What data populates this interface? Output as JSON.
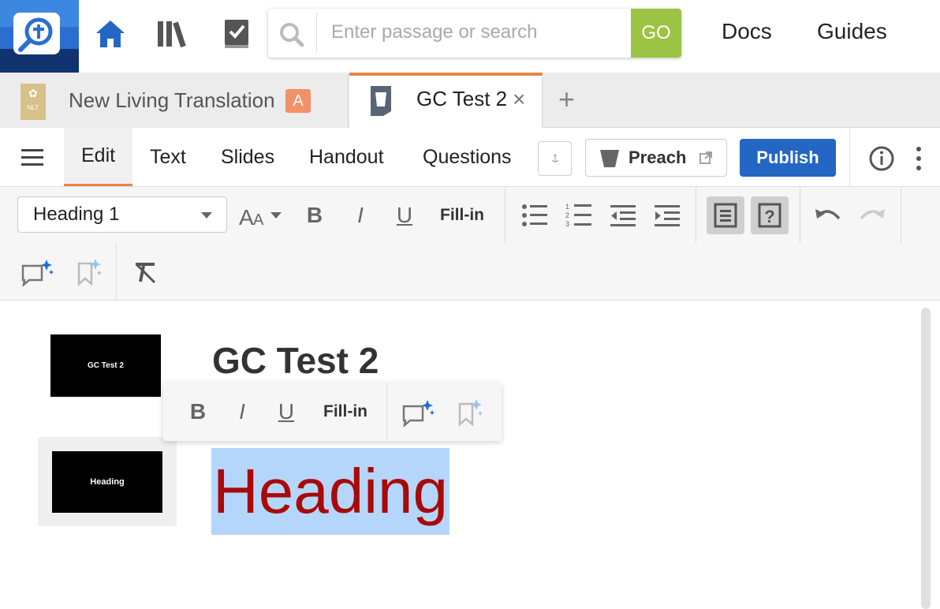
{
  "search": {
    "placeholder": "Enter passage or search",
    "go_label": "GO"
  },
  "topnav": {
    "docs_label": "Docs",
    "guides_label": "Guides"
  },
  "tabs": [
    {
      "label": "New Living Translation",
      "badge": "A",
      "book_abbr": "NLT"
    },
    {
      "label": "GC Test 2",
      "close": "×"
    }
  ],
  "add_tab": "+",
  "modes": {
    "edit": "Edit",
    "text": "Text",
    "slides": "Slides",
    "handout": "Handout",
    "questions": "Questions"
  },
  "preach_label": "Preach",
  "publish_label": "Publish",
  "format": {
    "style_value": "Heading 1",
    "bold": "B",
    "italic": "I",
    "underline": "U",
    "fillin": "Fill-in"
  },
  "document": {
    "title": "GC Test 2",
    "selected_heading": "Heading",
    "slide1_text": "GC Test 2",
    "slide2_text": "Heading"
  },
  "colors": {
    "accent_orange": "#e8844a",
    "publish_blue": "#2466c4",
    "go_green": "#9bc444",
    "heading_red": "#a80a0a",
    "selection": "#b5d6fb"
  }
}
